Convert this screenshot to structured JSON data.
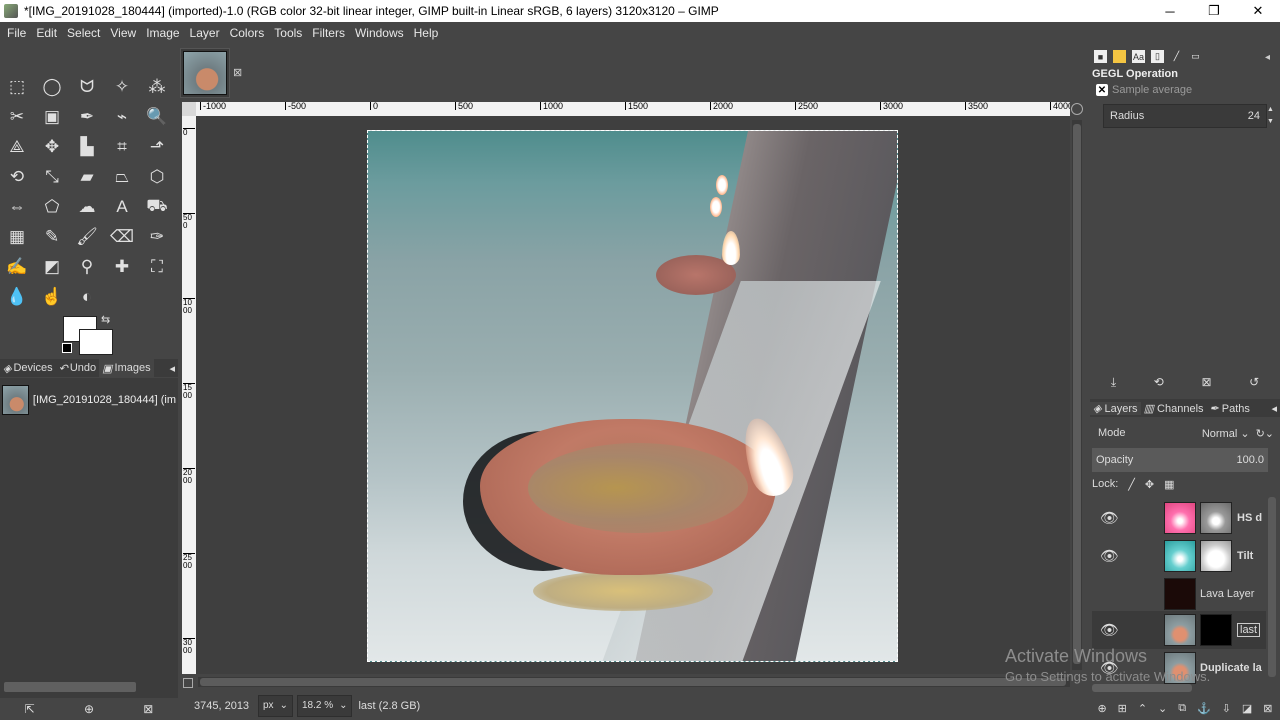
{
  "window": {
    "title": "*[IMG_20191028_180444] (imported)-1.0 (RGB color 32-bit linear integer, GIMP built-in Linear sRGB, 6 layers) 3120x3120 – GIMP",
    "minimize": "─",
    "maximize": "❐",
    "close": "✕"
  },
  "menu": [
    "File",
    "Edit",
    "Select",
    "View",
    "Image",
    "Layer",
    "Colors",
    "Tools",
    "Filters",
    "Windows",
    "Help"
  ],
  "tools": [
    {
      "name": "rect-select-icon",
      "glyph": "⬚"
    },
    {
      "name": "ellipse-select-icon",
      "glyph": "◯"
    },
    {
      "name": "free-select-icon",
      "glyph": "ᗢ"
    },
    {
      "name": "fuzzy-select-icon",
      "glyph": "✧"
    },
    {
      "name": "select-by-color-icon",
      "glyph": "⁂"
    },
    {
      "name": "scissors-icon",
      "glyph": "✂"
    },
    {
      "name": "foreground-select-icon",
      "glyph": "▣"
    },
    {
      "name": "paths-icon",
      "glyph": "✒"
    },
    {
      "name": "color-picker-icon",
      "glyph": "⌁"
    },
    {
      "name": "zoom-icon",
      "glyph": "🔍"
    },
    {
      "name": "measure-icon",
      "glyph": "⟁"
    },
    {
      "name": "move-icon",
      "glyph": "✥"
    },
    {
      "name": "align-icon",
      "glyph": "▙"
    },
    {
      "name": "crop-icon",
      "glyph": "⌗"
    },
    {
      "name": "unified-transform-icon",
      "glyph": "⬏"
    },
    {
      "name": "rotate-icon",
      "glyph": "⟲"
    },
    {
      "name": "scale-icon",
      "glyph": "⤡"
    },
    {
      "name": "shear-icon",
      "glyph": "▰"
    },
    {
      "name": "perspective-icon",
      "glyph": "⏢"
    },
    {
      "name": "3d-transform-icon",
      "glyph": "⬡"
    },
    {
      "name": "warp-icon",
      "glyph": "⇔"
    },
    {
      "name": "cage-icon",
      "glyph": "⬠"
    },
    {
      "name": "smudge-warp-icon",
      "glyph": "☁"
    },
    {
      "name": "text-icon",
      "glyph": "A"
    },
    {
      "name": "bucket-fill-icon",
      "glyph": "⛟"
    },
    {
      "name": "gradient-icon",
      "glyph": "▦"
    },
    {
      "name": "pencil-icon",
      "glyph": "✎"
    },
    {
      "name": "paintbrush-icon",
      "glyph": "🖌"
    },
    {
      "name": "eraser-icon",
      "glyph": "⌫"
    },
    {
      "name": "airbrush-icon",
      "glyph": "✑"
    },
    {
      "name": "ink-icon",
      "glyph": "✍"
    },
    {
      "name": "mypaint-brush-icon",
      "glyph": "◩"
    },
    {
      "name": "clone-icon",
      "glyph": "⚲"
    },
    {
      "name": "heal-icon",
      "glyph": "✚"
    },
    {
      "name": "perspective-clone-icon",
      "glyph": "⛶"
    },
    {
      "name": "blur-icon",
      "glyph": "💧"
    },
    {
      "name": "smudge-icon",
      "glyph": "☝"
    },
    {
      "name": "dodge-burn-icon",
      "glyph": "◐"
    }
  ],
  "colors": {
    "foreground": "#ffffff",
    "background": "#ffffff"
  },
  "left_tabs": [
    {
      "label": "Devices",
      "icon": "devices-icon"
    },
    {
      "label": "Undo",
      "icon": "undo-icon"
    },
    {
      "label": "Images",
      "icon": "images-icon"
    }
  ],
  "images_list": [
    {
      "label": "[IMG_20191028_180444] (im"
    }
  ],
  "ruler_h": [
    "-1000",
    "-500",
    "0",
    "500",
    "1000",
    "1500",
    "2000",
    "2500",
    "3000",
    "3500",
    "4000"
  ],
  "ruler_v": [
    "0",
    "500",
    "1000",
    "1500",
    "2000",
    "2500",
    "3000"
  ],
  "status": {
    "coords": "3745, 2013",
    "unit": "px",
    "zoom": "18.2 %",
    "message": "last (2.8 GB)"
  },
  "gegl": {
    "title": "GEGL Operation",
    "subtitle": "Sample average",
    "radius_label": "Radius",
    "radius_value": "24"
  },
  "right_tabs": [
    {
      "label": "Layers",
      "icon": "layers-icon"
    },
    {
      "label": "Channels",
      "icon": "channels-icon"
    },
    {
      "label": "Paths",
      "icon": "paths-icon"
    }
  ],
  "layers_panel": {
    "mode_label": "Mode",
    "mode_value": "Normal",
    "opacity_label": "Opacity",
    "opacity_value": "100.0",
    "lock_label": "Lock:",
    "layers": [
      {
        "name": "HS d",
        "visible": true
      },
      {
        "name": "Tilt",
        "visible": true
      },
      {
        "name": "Lava Layer",
        "visible": false
      },
      {
        "name": "last",
        "visible": true
      },
      {
        "name": "Duplicate la",
        "visible": true
      }
    ]
  },
  "watermark": {
    "line1": "Activate Windows",
    "line2": "Go to Settings to activate Windows."
  }
}
